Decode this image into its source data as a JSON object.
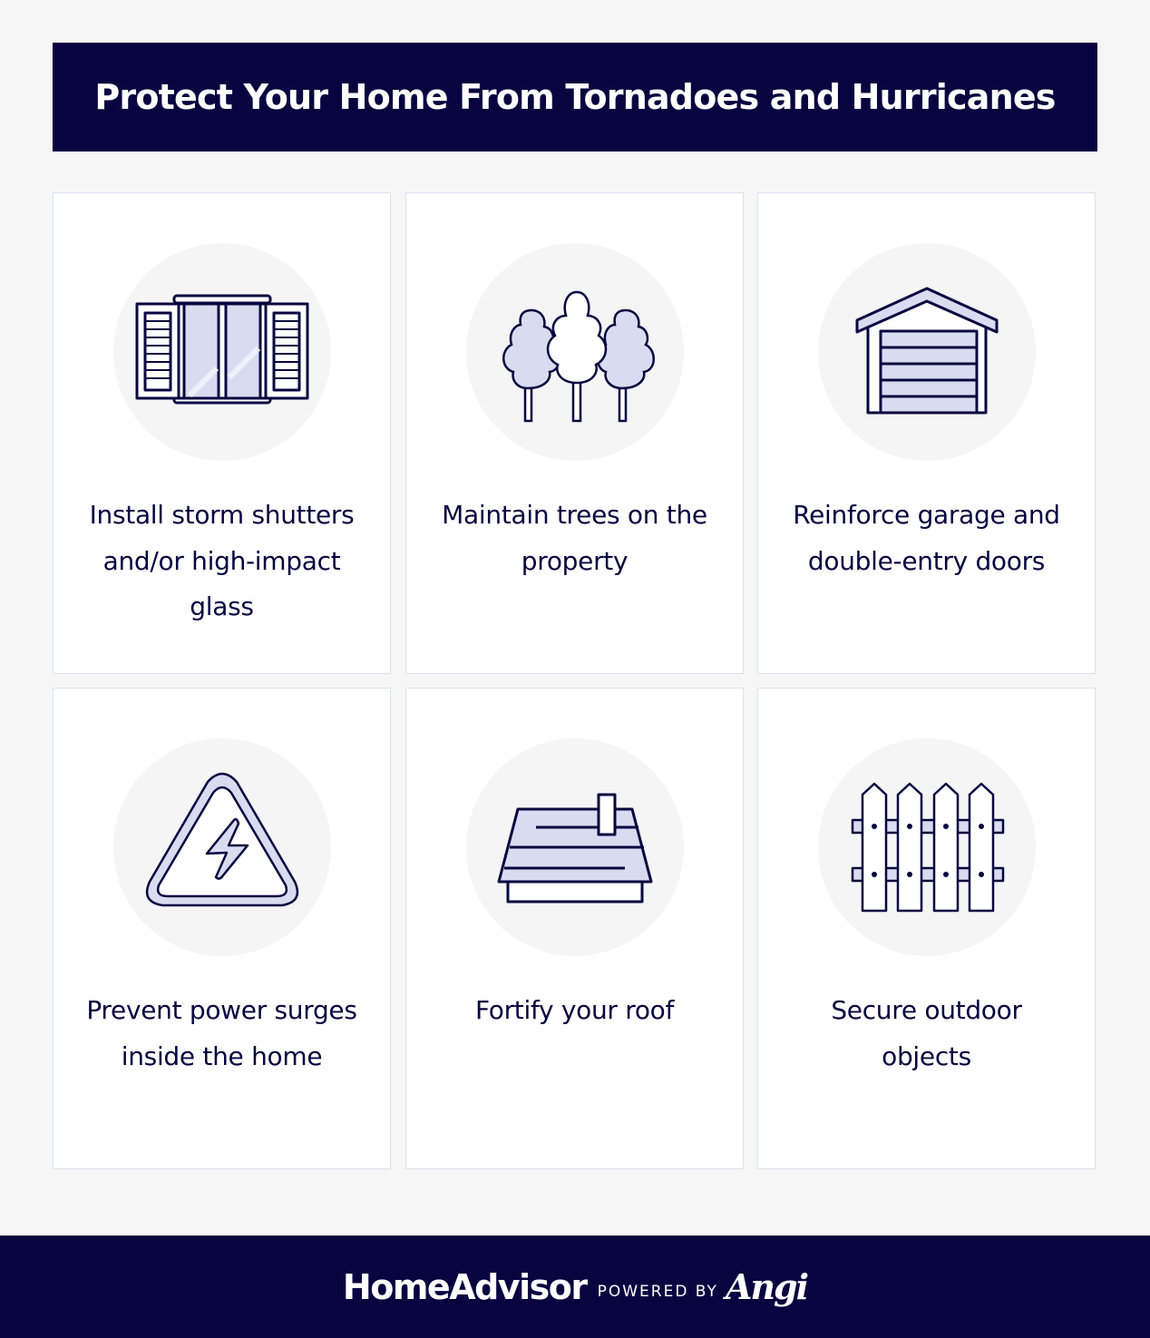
{
  "header": {
    "title": "Protect Your Home From Tornadoes and Hurricanes"
  },
  "colors": {
    "navy": "#08043f",
    "lavender": "#d8dcf0",
    "circle_bg": "#f5f5f6",
    "page_bg": "#f6f6f6",
    "card_border": "#dde0f3"
  },
  "tips": [
    {
      "icon": "window-shutters-icon",
      "label": "Install storm shutters and/or high-impact glass"
    },
    {
      "icon": "trees-icon",
      "label": "Maintain trees on the property"
    },
    {
      "icon": "garage-icon",
      "label": "Reinforce garage and double-entry doors"
    },
    {
      "icon": "power-surge-warning-icon",
      "label": "Prevent power surges inside the home"
    },
    {
      "icon": "roof-icon",
      "label": "Fortify your roof"
    },
    {
      "icon": "fence-icon",
      "label": "Secure outdoor objects"
    }
  ],
  "footer": {
    "brand": "HomeAdvisor",
    "powered_by": "POWERED BY",
    "partner": "Angi"
  }
}
